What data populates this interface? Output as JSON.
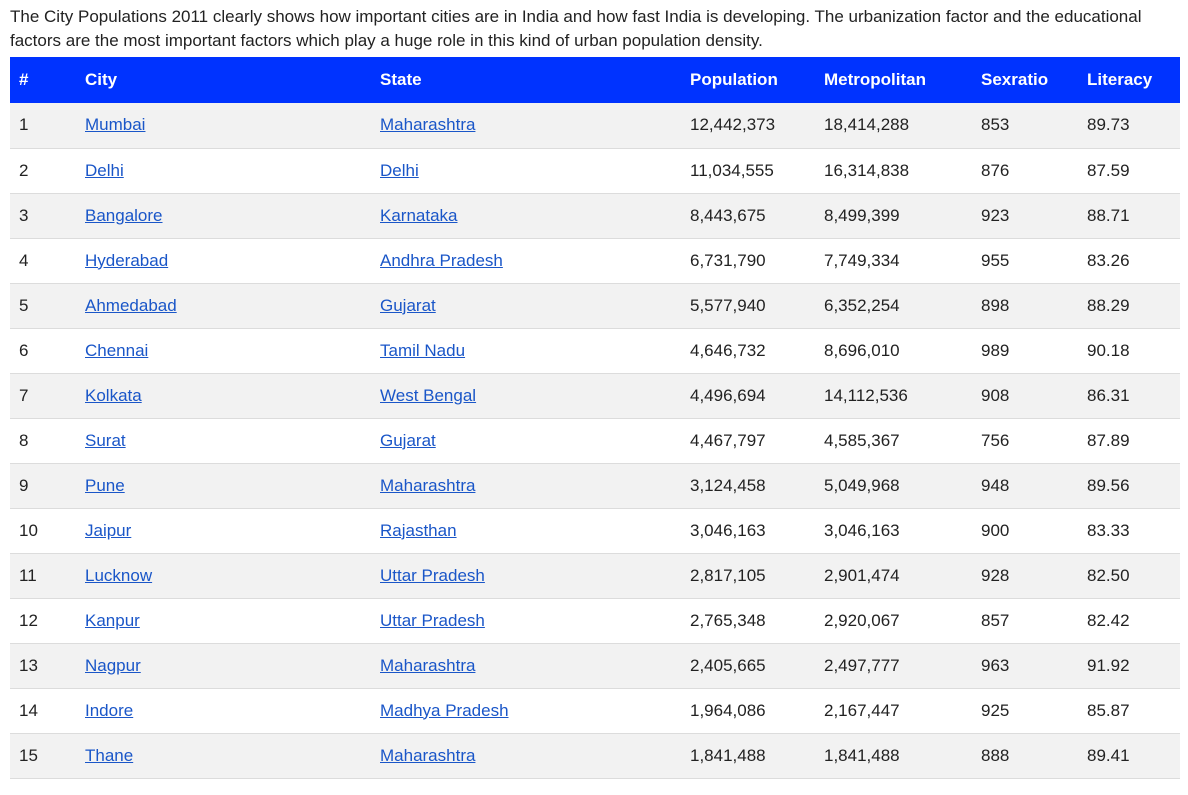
{
  "intro_text": "The City Populations 2011 clearly shows how important cities are in India and how fast India is developing. The urbanization factor and the educational factors are the most important factors which play a huge role in this kind of urban population density.",
  "table": {
    "headers": [
      "#",
      "City",
      "State",
      "Population",
      "Metropolitan",
      "Sexratio",
      "Literacy"
    ],
    "header_color": "#0033ff",
    "link_color": "#1a56c8",
    "rows": [
      [
        "1",
        "Mumbai",
        "Maharashtra",
        "12,442,373",
        "18,414,288",
        "853",
        "89.73"
      ],
      [
        "2",
        "Delhi",
        "Delhi",
        "11,034,555",
        "16,314,838",
        "876",
        "87.59"
      ],
      [
        "3",
        "Bangalore",
        "Karnataka",
        "8,443,675",
        "8,499,399",
        "923",
        "88.71"
      ],
      [
        "4",
        "Hyderabad",
        "Andhra Pradesh",
        "6,731,790",
        "7,749,334",
        "955",
        "83.26"
      ],
      [
        "5",
        "Ahmedabad",
        "Gujarat",
        "5,577,940",
        "6,352,254",
        "898",
        "88.29"
      ],
      [
        "6",
        "Chennai",
        "Tamil Nadu",
        "4,646,732",
        "8,696,010",
        "989",
        "90.18"
      ],
      [
        "7",
        "Kolkata",
        "West Bengal",
        "4,496,694",
        "14,112,536",
        "908",
        "86.31"
      ],
      [
        "8",
        "Surat",
        "Gujarat",
        "4,467,797",
        "4,585,367",
        "756",
        "87.89"
      ],
      [
        "9",
        "Pune",
        "Maharashtra",
        "3,124,458",
        "5,049,968",
        "948",
        "89.56"
      ],
      [
        "10",
        "Jaipur",
        "Rajasthan",
        "3,046,163",
        "3,046,163",
        "900",
        "83.33"
      ],
      [
        "11",
        "Lucknow",
        "Uttar Pradesh",
        "2,817,105",
        "2,901,474",
        "928",
        "82.50"
      ],
      [
        "12",
        "Kanpur",
        "Uttar Pradesh",
        "2,765,348",
        "2,920,067",
        "857",
        "82.42"
      ],
      [
        "13",
        "Nagpur",
        "Maharashtra",
        "2,405,665",
        "2,497,777",
        "963",
        "91.92"
      ],
      [
        "14",
        "Indore",
        "Madhya Pradesh",
        "1,964,086",
        "2,167,447",
        "925",
        "85.87"
      ],
      [
        "15",
        "Thane",
        "Maharashtra",
        "1,841,488",
        "1,841,488",
        "888",
        "89.41"
      ]
    ]
  }
}
